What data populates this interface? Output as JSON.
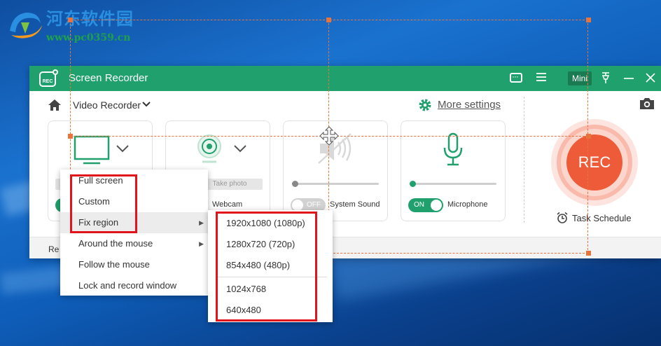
{
  "watermark": {
    "title": "河东软件园",
    "url": "www.pc0359.cn"
  },
  "window": {
    "logo_text": "REC",
    "title": "Screen Recorder",
    "mini_label": "Mini"
  },
  "toolbar": {
    "mode_label": "Video Recorder",
    "more_settings": "More settings"
  },
  "cards": {
    "webcam": {
      "photo_button": "Take photo",
      "label": "Webcam"
    },
    "system_sound": {
      "toggle": "OFF",
      "label": "System Sound"
    },
    "microphone": {
      "toggle": "ON",
      "label": "Microphone"
    }
  },
  "rec": {
    "button": "REC",
    "task_schedule": "Task Schedule"
  },
  "bottom_bar": {
    "text": "Re"
  },
  "region_menu": {
    "items": [
      {
        "label": "Full screen"
      },
      {
        "label": "Custom"
      },
      {
        "label": "Fix region",
        "has_submenu": true
      },
      {
        "label": "Around the mouse",
        "has_submenu": true
      },
      {
        "label": "Follow the mouse"
      },
      {
        "label": "Lock and record window"
      }
    ],
    "submenu_arrow": "▶"
  },
  "fix_region_submenu": {
    "items": [
      {
        "label": "1920x1080 (1080p)"
      },
      {
        "label": "1280x720 (720p)"
      },
      {
        "label": "854x480 (480p)"
      },
      {
        "label": "1024x768"
      },
      {
        "label": "640x480"
      }
    ]
  },
  "colors": {
    "brand_green": "#20a06c",
    "rec_red": "#ee5b38",
    "highlight_red": "#e2141b",
    "region_orange": "#e8743d"
  }
}
